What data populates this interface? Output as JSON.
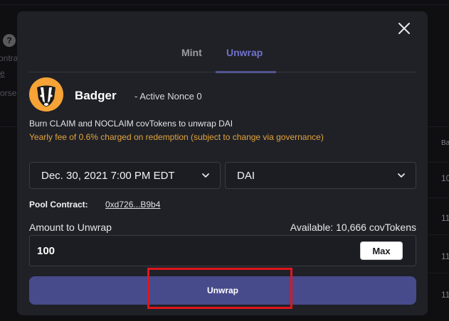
{
  "background": {
    "help_glyph": "?",
    "fragments": [
      "ontra",
      "e",
      "orse"
    ],
    "table_header": "Ba",
    "table_values": [
      "10",
      "11",
      "11",
      "11"
    ]
  },
  "modal": {
    "close_icon": "close-icon",
    "tabs": [
      {
        "label": "Mint",
        "active": false
      },
      {
        "label": "Unwrap",
        "active": true
      }
    ],
    "project": {
      "name": "Badger",
      "nonce_text": "- Active Nonce 0",
      "logo_icon": "badger-logo"
    },
    "description": "Burn CLAIM and NOCLAIM covTokens to unwrap DAI",
    "fee_note": "Yearly fee of 0.6% charged on redemption (subject to change via governance)",
    "expiry_select": {
      "value": "Dec. 30, 2021 7:00 PM EDT"
    },
    "token_select": {
      "value": "DAI"
    },
    "pool_contract": {
      "label": "Pool Contract:",
      "address": "0xd726...B9b4"
    },
    "amount": {
      "label": "Amount to Unwrap",
      "available": "Available: 10,666 covTokens",
      "value": "100",
      "max_label": "Max"
    },
    "submit_label": "Unwrap"
  },
  "colors": {
    "accent": "#474b8b",
    "active_tab": "#6f72c9",
    "fee_text": "#e2a43c",
    "logo_bg": "#f7a336",
    "highlight": "#e0161e"
  }
}
